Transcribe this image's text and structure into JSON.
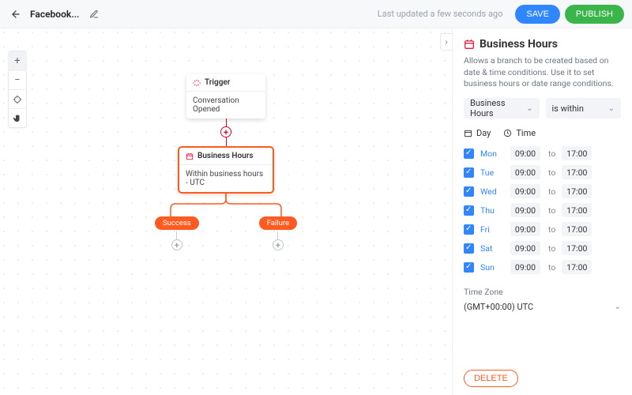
{
  "header": {
    "back_icon": "arrow-left",
    "title": "Facebook...",
    "pencil_icon": "pencil",
    "last_updated": "Last updated a few seconds ago",
    "save_label": "SAVE",
    "publish_label": "PUBLISH"
  },
  "canvas": {
    "toolbox": {
      "zoom_in": "+",
      "zoom_out": "−",
      "recenter": "⌖",
      "pan": "✋"
    },
    "collapse_icon": "›",
    "trigger": {
      "title": "Trigger",
      "subtitle": "Conversation Opened"
    },
    "selected": {
      "title": "Business Hours",
      "subtitle": "Within business hours - UTC"
    },
    "branches": {
      "success": "Success",
      "failure": "Failure"
    }
  },
  "panel": {
    "title": "Business Hours",
    "description": "Allows a branch to be created based on date & time conditions. Use it to set business hours or date range conditions.",
    "field_select": "Business Hours",
    "operator_select": "is within",
    "tabs": {
      "day": "Day",
      "time": "Time"
    },
    "days": [
      {
        "label": "Mon",
        "from": "09:00",
        "to_label": "to",
        "to": "17:00"
      },
      {
        "label": "Tue",
        "from": "09:00",
        "to_label": "to",
        "to": "17:00"
      },
      {
        "label": "Wed",
        "from": "09:00",
        "to_label": "to",
        "to": "17:00"
      },
      {
        "label": "Thu",
        "from": "09:00",
        "to_label": "to",
        "to": "17:00"
      },
      {
        "label": "Fri",
        "from": "09:00",
        "to_label": "to",
        "to": "17:00"
      },
      {
        "label": "Sat",
        "from": "09:00",
        "to_label": "to",
        "to": "17:00"
      },
      {
        "label": "Sun",
        "from": "09:00",
        "to_label": "to",
        "to": "17:00"
      }
    ],
    "timezone": {
      "label": "Time Zone",
      "value": "(GMT+00:00) UTC"
    },
    "delete_label": "DELETE"
  }
}
